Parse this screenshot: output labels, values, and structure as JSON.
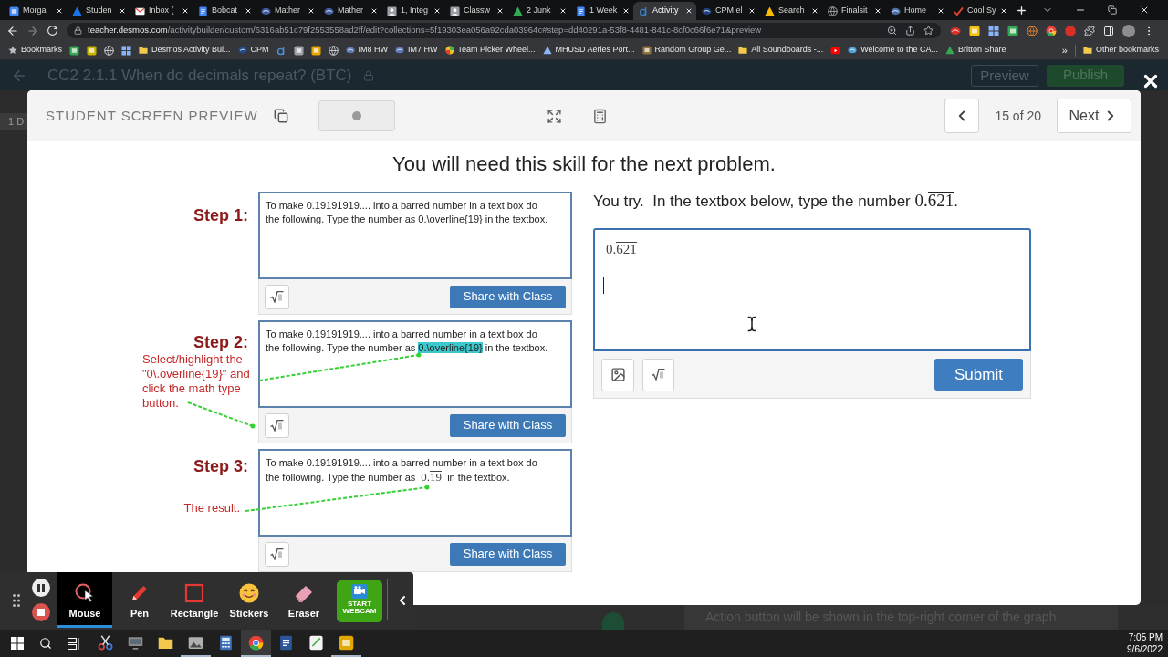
{
  "browser": {
    "tabs": [
      {
        "title": "Morga",
        "selected": false
      },
      {
        "title": "Studen",
        "selected": false
      },
      {
        "title": "Inbox (",
        "selected": false
      },
      {
        "title": "Bobcat",
        "selected": false
      },
      {
        "title": "Mather",
        "selected": false
      },
      {
        "title": "Mather",
        "selected": false
      },
      {
        "title": "1, Integ",
        "selected": false
      },
      {
        "title": "Classw",
        "selected": false
      },
      {
        "title": "2 Junk",
        "selected": false
      },
      {
        "title": "1 Week",
        "selected": false
      },
      {
        "title": "Activity",
        "selected": true
      },
      {
        "title": "CPM el",
        "selected": false
      },
      {
        "title": "Search",
        "selected": false
      },
      {
        "title": "Finalsit",
        "selected": false
      },
      {
        "title": "Home",
        "selected": false
      },
      {
        "title": "Cool Sy",
        "selected": false
      }
    ],
    "address": {
      "domain": "teacher.desmos.com",
      "path": "/activitybuilder/custom/6316ab51c79f2553558ad2ff/edit?collections=5f19303ea056a92cda03964c#step=dd40291a-53f8-4481-841c-8cf0c66f6e71&preview"
    },
    "bookmarks": [
      {
        "kind": "link",
        "label": "Bookmarks"
      },
      {
        "kind": "icon"
      },
      {
        "kind": "icon"
      },
      {
        "kind": "icon"
      },
      {
        "kind": "icon"
      },
      {
        "kind": "link",
        "label": "Desmos Activity Bui..."
      },
      {
        "kind": "link",
        "label": "CPM"
      },
      {
        "kind": "icon"
      },
      {
        "kind": "icon"
      },
      {
        "kind": "icon"
      },
      {
        "kind": "icon"
      },
      {
        "kind": "link",
        "label": "IM8 HW"
      },
      {
        "kind": "link",
        "label": "IM7 HW"
      },
      {
        "kind": "link",
        "label": "Team Picker Wheel..."
      },
      {
        "kind": "link",
        "label": "MHUSD Aeries Port..."
      },
      {
        "kind": "link",
        "label": "Random Group Ge..."
      },
      {
        "kind": "link",
        "label": "All Soundboards -..."
      },
      {
        "kind": "icon"
      },
      {
        "kind": "link",
        "label": "Welcome to the CA..."
      },
      {
        "kind": "link",
        "label": "Britton Share"
      }
    ],
    "overflow": "»",
    "other_bookmarks": "Other bookmarks"
  },
  "editor": {
    "title": "CC2 2.1.1 When do decimals repeat? (BTC)",
    "side_tab": "1 D",
    "buttons": [
      {
        "label": "Preview",
        "kind": "outline"
      },
      {
        "label": "Publish",
        "kind": "primary"
      }
    ],
    "hint": "Action button will be shown in the top-right corner of the graph"
  },
  "preview": {
    "header": "STUDENT SCREEN PREVIEW",
    "counter": "15 of 20",
    "next": "Next",
    "heading": "You will need this skill for the next problem.",
    "steps": [
      {
        "label": "Step 1:",
        "text": [
          {
            "kind": "text",
            "text": "To make 0.19191919.... into a barred number in a text box do the following. Type the number as 0.\\overline{19} in the textbox."
          }
        ],
        "button": "Share with Class"
      },
      {
        "label": "Step 2:",
        "note": "Select/highlight the \"0\\.overline{19}\" and click the math type button.",
        "text": [
          {
            "kind": "text",
            "text": "To make 0.19191919.... into a barred number in a text box do the following. Type the number as "
          },
          {
            "kind": "highlight",
            "text": "0.\\overline{19}"
          },
          {
            "kind": "text",
            "text": " in the textbox."
          }
        ],
        "button": "Share with Class"
      },
      {
        "label": "Step 3:",
        "note": "The result.",
        "text": [
          {
            "kind": "text",
            "text": "To make 0.19191919.... into a barred number in a text box do the following. Type the number as "
          },
          {
            "kind": "math",
            "whole": "0.",
            "repeating": "19"
          },
          {
            "kind": "text",
            "text": " in the textbox."
          }
        ],
        "button": "Share with Class"
      }
    ],
    "prompt": {
      "text": "You try.  In the textbox below, type the number ",
      "math": {
        "whole": "0.",
        "repeating": "621"
      },
      "end": "."
    },
    "answer": {
      "whole": "0.",
      "repeating": "621"
    },
    "submit": "Submit"
  },
  "recorder": {
    "tools": [
      {
        "label": "Mouse",
        "selected": true
      },
      {
        "label": "Pen",
        "selected": false
      },
      {
        "label": "Rectangle",
        "selected": false
      },
      {
        "label": "Stickers",
        "selected": false
      },
      {
        "label": "Eraser",
        "selected": false
      }
    ],
    "webcam": "START WEBCAM"
  },
  "taskbar": {
    "apps": [
      {
        "running": false,
        "selected": false
      },
      {
        "running": false,
        "selected": false
      },
      {
        "running": false,
        "selected": false
      },
      {
        "running": true,
        "selected": false
      },
      {
        "running": false,
        "selected": false
      },
      {
        "running": true,
        "selected": true
      },
      {
        "running": false,
        "selected": false
      },
      {
        "running": false,
        "selected": false
      },
      {
        "running": true,
        "selected": false
      }
    ],
    "time": "7:05 PM",
    "date": "9/6/2022"
  }
}
